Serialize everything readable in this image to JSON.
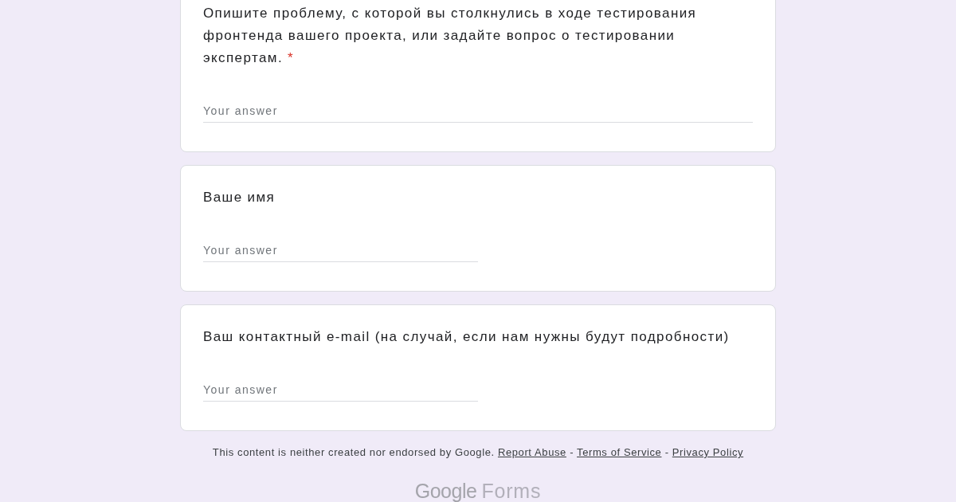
{
  "required_mark": "*",
  "questions": [
    {
      "title": "Опишите проблему, с которой вы столкнулись в ходе тестирования фронтенда вашего проекта, или задайте вопрос о тестировании экспертам.",
      "required": true,
      "answer": {
        "kind": "long",
        "placeholder": "Your answer"
      }
    },
    {
      "title": "Ваше имя",
      "required": false,
      "answer": {
        "kind": "short",
        "placeholder": "Your answer"
      }
    },
    {
      "title": "Ваш контактный e-mail (на случай, если нам нужны будут подробности)",
      "required": false,
      "answer": {
        "kind": "short",
        "placeholder": "Your answer"
      }
    }
  ],
  "footer": {
    "disclaimer": "This content is neither created nor endorsed by Google.",
    "separator": "-",
    "links": [
      "Report Abuse",
      "Terms of Service",
      "Privacy Policy"
    ]
  },
  "logo": {
    "brand": "Google",
    "product": "Forms"
  }
}
